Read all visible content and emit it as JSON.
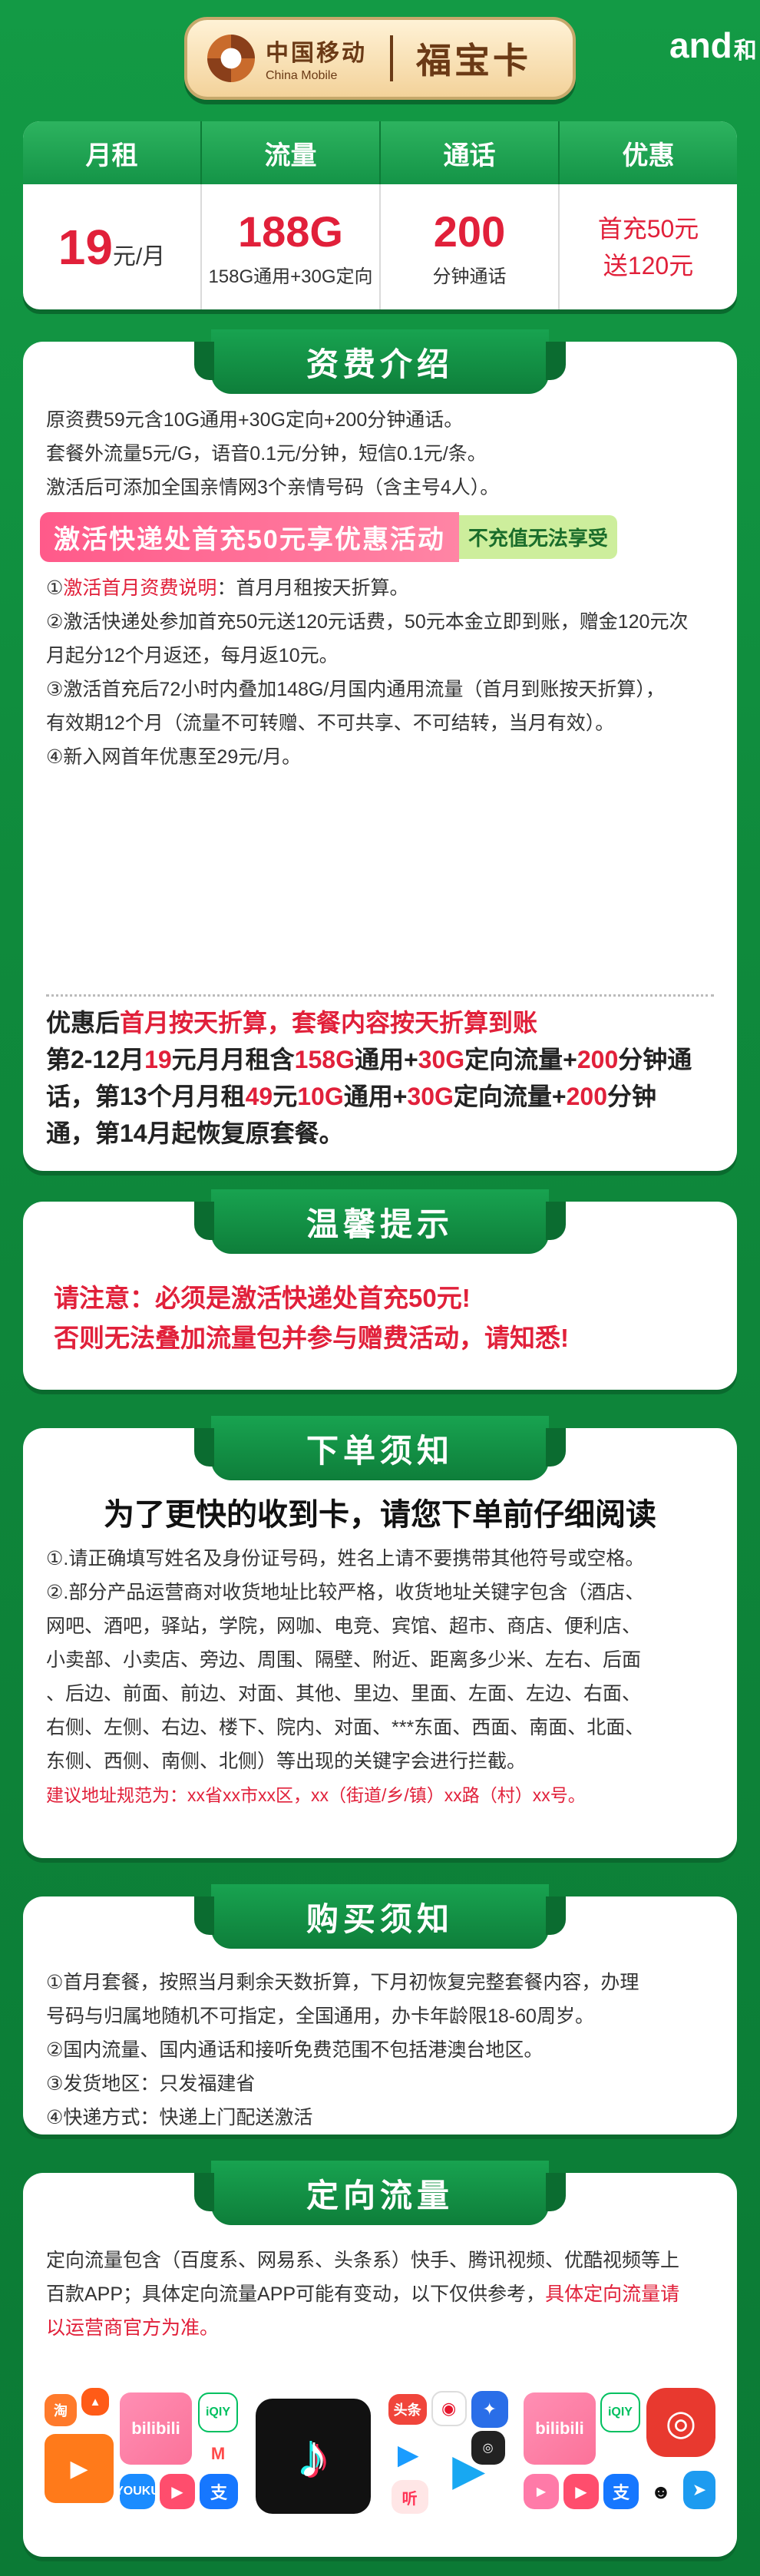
{
  "header": {
    "brand_cn": "中国移动",
    "brand_en": "China Mobile",
    "card_name": "福宝卡",
    "he_logo_o": "and",
    "he_logo_char": "和"
  },
  "summary": {
    "headers": [
      "月租",
      "流量",
      "通话",
      "优惠"
    ],
    "rent_value": "19",
    "rent_unit": "元/月",
    "data_value": "188G",
    "data_sub": "158G通用+30G定向",
    "call_value": "200",
    "call_sub": "分钟通话",
    "promo_line1": "首充50元",
    "promo_line2": "送120元"
  },
  "fee": {
    "title": "资费介绍",
    "lines": [
      "原资费59元含10G通用+30G定向+200分钟通话。",
      "套餐外流量5元/G，语音0.1元/分钟，短信0.1元/条。",
      "激活后可添加全国亲情网3个亲情号码（含主号4人）。"
    ],
    "banner_main": "激活快递处首充50元享优惠活动",
    "banner_tag": "不充值无法享受",
    "item1_prefix": "①",
    "item1_red": "激活首月资费说明",
    "item1_rest": "：首月月租按天折算。",
    "item2a": "②激活快递处参加首充50元送120元话费，50元本金立即到账，赠金120元次",
    "item2b": "月起分12个月返还，每月返10元。",
    "item3a": "③激活首充后72小时内叠加148G/月国内通用流量（首月到账按天折算），",
    "item3b": "有效期12个月（流量不可转赠、不可共享、不可结转，当月有效）。",
    "item4": "④新入网首年优惠至29元/月。",
    "d1_a": "优惠后",
    "d1_b": "首月按天折算，套餐内容按天折算到账",
    "d2_a": "第2-12月",
    "d2_b": "19",
    "d2_c": "元月月租含",
    "d2_d": "158G",
    "d2_e": "通用+",
    "d2_f": "30G",
    "d2_g": "定向流量+",
    "d2_h": "200",
    "d2_i": "分钟通",
    "d3_a": "话，第13个月月租",
    "d3_b": "49",
    "d3_c": "元",
    "d3_d": "10G",
    "d3_e": "通用+",
    "d3_f": "30G",
    "d3_g": "定向流量+",
    "d3_h": "200",
    "d3_i": "分钟",
    "d4": "通，第14月起恢复原套餐。"
  },
  "tips": {
    "title": "温馨提示",
    "line1": "请注意：必须是激活快递处首充50元!",
    "line2": "否则无法叠加流量包并参与赠费活动，请知悉!"
  },
  "order": {
    "title": "下单须知",
    "lead": "为了更快的收到卡，请您下单前仔细阅读",
    "lines": [
      "①.请正确填写姓名及身份证号码，姓名上请不要携带其他符号或空格。",
      "②.部分产品运营商对收货地址比较严格，收货地址关键字包含（酒店、",
      "网吧、酒吧，驿站，学院，网咖、电竞、宾馆、超市、商店、便利店、",
      "小卖部、小卖店、旁边、周围、隔壁、附近、距离多少米、左右、后面",
      "、后边、前面、前边、对面、其他、里边、里面、左面、左边、右面、",
      "右侧、左侧、右边、楼下、院内、对面、***东面、西面、南面、北面、",
      "东侧、西侧、南侧、北侧）等出现的关键字会进行拦截。"
    ],
    "address_tip": "建议地址规范为：xx省xx市xx区，xx（街道/乡/镇）xx路（村）xx号。"
  },
  "buy": {
    "title": "购买须知",
    "lines": [
      "①首月套餐，按照当月剩余天数折算，下月初恢复完整套餐内容，办理",
      "号码与归属地随机不可指定，全国通用，办卡年龄限18-60周岁。",
      "②国内流量、国内通话和接听免费范围不包括港澳台地区。",
      "③发货地区：只发福建省",
      "④快递方式：快递上门配送激活"
    ]
  },
  "flow": {
    "title": "定向流量",
    "line1": "定向流量包含（百度系、网易系、头条系）快手、腾讯视频、优酷视频等上",
    "line2_a": "百款APP；具体定向流量APP可能有变动，以下仅供参考，",
    "line2_b": "具体定向流量请",
    "line3": "以运营商官方为准。",
    "app_labels": [
      "淘",
      "bilibili",
      "iQIY",
      "头条",
      "听",
      "bilibili",
      "iQIY",
      "支",
      "YOUKU"
    ]
  },
  "colors": {
    "green": "#139a45",
    "red": "#e1203a",
    "pink": "#ff5a8a",
    "gold": "#f3d29a"
  }
}
